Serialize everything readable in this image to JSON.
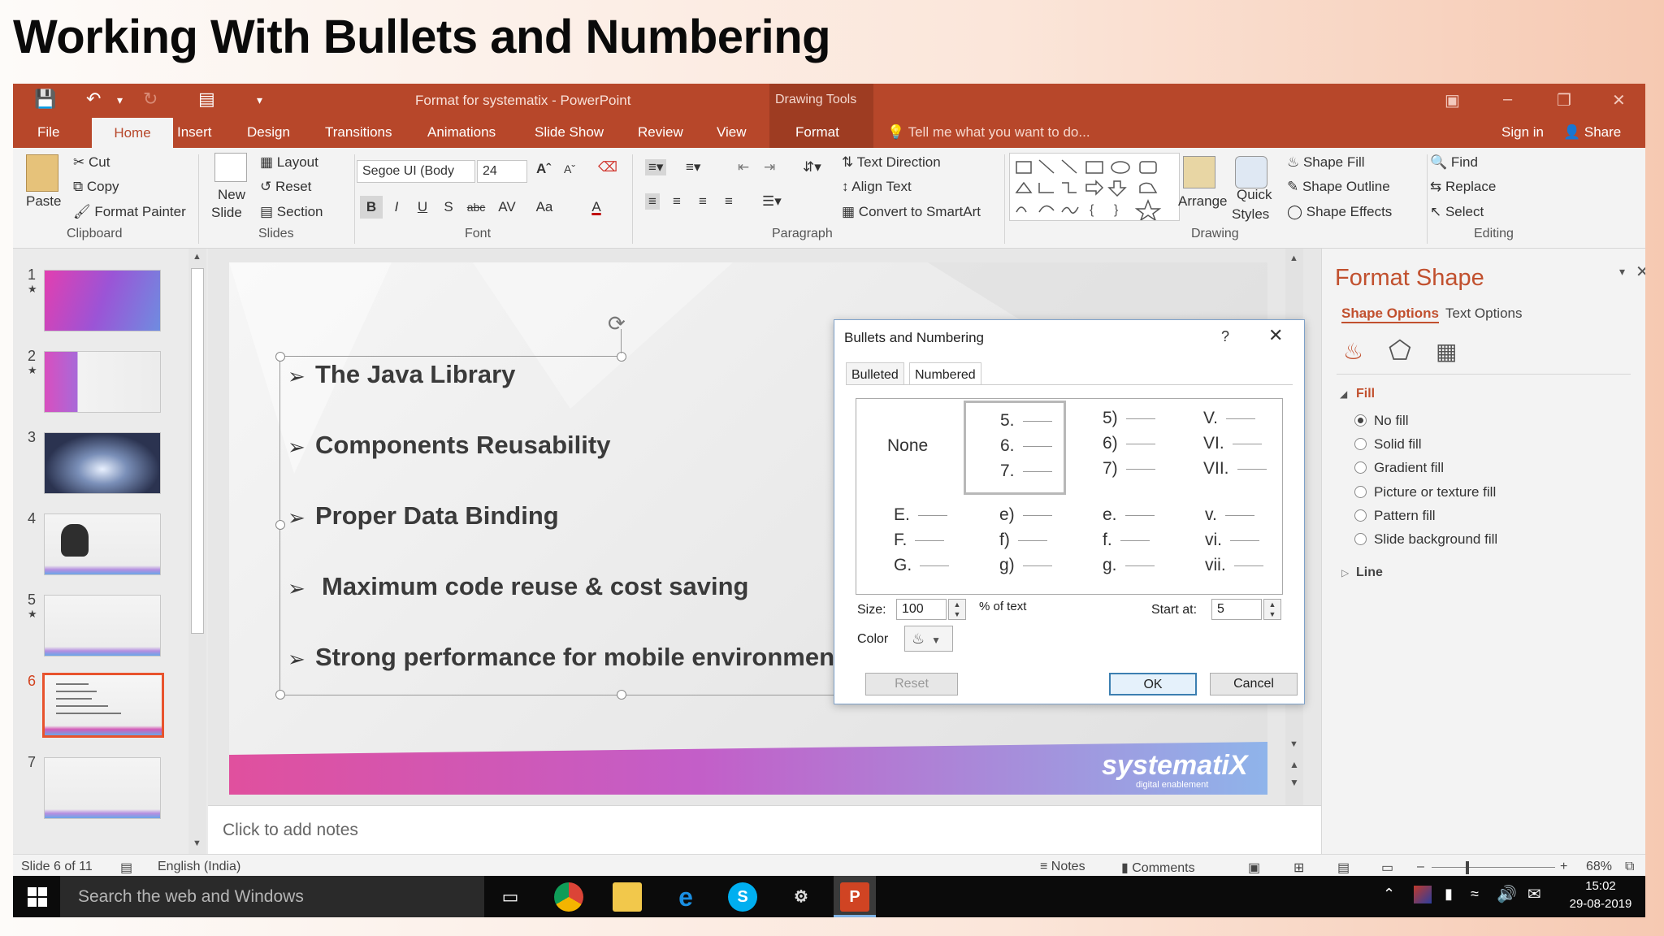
{
  "heading": "Working With Bullets and Numbering",
  "window": {
    "title": "Format for systematix - PowerPoint",
    "context_tab": "Drawing Tools",
    "tabs": [
      "File",
      "Home",
      "Insert",
      "Design",
      "Transitions",
      "Animations",
      "Slide Show",
      "Review",
      "View",
      "Format"
    ],
    "active_tab": "Home",
    "tell_me": "Tell me what you want to do...",
    "sign_in": "Sign in",
    "share": "Share"
  },
  "ribbon": {
    "clipboard": {
      "paste": "Paste",
      "cut": "Cut",
      "copy": "Copy",
      "format_painter": "Format Painter",
      "group": "Clipboard"
    },
    "slides": {
      "new_slide_1": "New",
      "new_slide_2": "Slide",
      "layout": "Layout",
      "reset": "Reset",
      "section": "Section",
      "group": "Slides"
    },
    "font": {
      "name": "Segoe UI (Body",
      "size": "24",
      "bold": "B",
      "italic": "I",
      "underline": "U",
      "shadow": "S",
      "strike": "abc",
      "spacing": "AV",
      "case": "Aa",
      "color": "A",
      "group": "Font"
    },
    "paragraph": {
      "text_direction": "Text Direction",
      "align_text": "Align Text",
      "convert_smartart": "Convert to SmartArt",
      "group": "Paragraph"
    },
    "drawing": {
      "arrange": "Arrange",
      "quick_styles_1": "Quick",
      "quick_styles_2": "Styles",
      "shape_fill": "Shape Fill",
      "shape_outline": "Shape Outline",
      "shape_effects": "Shape Effects",
      "group": "Drawing"
    },
    "editing": {
      "find": "Find",
      "replace": "Replace",
      "select": "Select",
      "group": "Editing"
    }
  },
  "thumbnails": [
    {
      "num": "1",
      "star": "★"
    },
    {
      "num": "2",
      "star": "★"
    },
    {
      "num": "3",
      "star": ""
    },
    {
      "num": "4",
      "star": ""
    },
    {
      "num": "5",
      "star": "★"
    },
    {
      "num": "6",
      "star": ""
    },
    {
      "num": "7",
      "star": ""
    }
  ],
  "slide": {
    "bullets": [
      "The Java Library",
      "Components Reusability",
      "Proper Data Binding",
      "Maximum code reuse & cost saving",
      "Strong performance for mobile environments"
    ],
    "logo": "systematiX",
    "logo_sub": "digital enablement"
  },
  "notes_placeholder": "Click to add notes",
  "dialog": {
    "title": "Bullets and Numbering",
    "help": "?",
    "tabs": [
      "Bulleted",
      "Numbered"
    ],
    "active_tab": "Numbered",
    "none_label": "None",
    "grid": [
      [
        "5.",
        "6.",
        "7."
      ],
      [
        "5)",
        "6)",
        "7)"
      ],
      [
        "V.",
        "VI.",
        "VII."
      ],
      [
        "E.",
        "F.",
        "G."
      ],
      [
        "e)",
        "f)",
        "g)"
      ],
      [
        "e.",
        "f.",
        "g."
      ],
      [
        "v.",
        "vi.",
        "vii."
      ]
    ],
    "size_label": "Size:",
    "size_value": "100",
    "size_unit": "% of text",
    "start_label": "Start at:",
    "start_value": "5",
    "color_label": "Color",
    "reset": "Reset",
    "ok": "OK",
    "cancel": "Cancel"
  },
  "format_pane": {
    "title": "Format Shape",
    "tab_shape": "Shape Options",
    "tab_text": "Text Options",
    "fill_section": "Fill",
    "fill_options": [
      "No fill",
      "Solid fill",
      "Gradient fill",
      "Picture or texture fill",
      "Pattern fill",
      "Slide background fill"
    ],
    "selected_fill": "No fill",
    "line_section": "Line"
  },
  "status": {
    "slide_info": "Slide 6 of 11",
    "language": "English (India)",
    "notes": "Notes",
    "comments": "Comments",
    "zoom": "68%"
  },
  "taskbar": {
    "search": "Search the web and Windows",
    "time": "15:02",
    "date": "29-08-2019"
  },
  "colors": {
    "accent": "#b7472a",
    "pane_title": "#c1502e",
    "selected_thumb": "#e8532d"
  }
}
